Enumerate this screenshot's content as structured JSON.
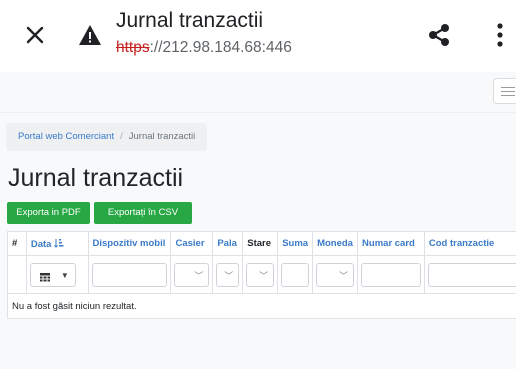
{
  "browser": {
    "title": "Jurnal tranzactii",
    "url_scheme": "https",
    "url_rest": "://212.98.184.68:446"
  },
  "breadcrumb": {
    "home": "Portal web Comerciant",
    "separator": "/",
    "current": "Jurnal tranzactii"
  },
  "page": {
    "title": "Jurnal tranzactii"
  },
  "actions": {
    "export_pdf": "Exporta in PDF",
    "export_csv": "Exportați în CSV"
  },
  "table": {
    "columns": {
      "index": "#",
      "date": "Data",
      "device": "Dispozitiv mobil",
      "cashier": "Casier",
      "pala": "Pala",
      "status": "Stare",
      "amount": "Suma",
      "currency": "Moneda",
      "card": "Numar card",
      "txn_code": "Cod tranzactie"
    },
    "empty_message": "Nu a fost găsit niciun rezultat."
  },
  "colors": {
    "button_green": "#28a745",
    "link_blue": "#3a7bc8",
    "url_insecure_red": "#c5221f"
  },
  "icons": [
    "close-icon",
    "warning-icon",
    "share-icon",
    "more-vert-icon",
    "hamburger-icon",
    "sort-icon",
    "calendar-icon",
    "chevron-down-icon"
  ]
}
